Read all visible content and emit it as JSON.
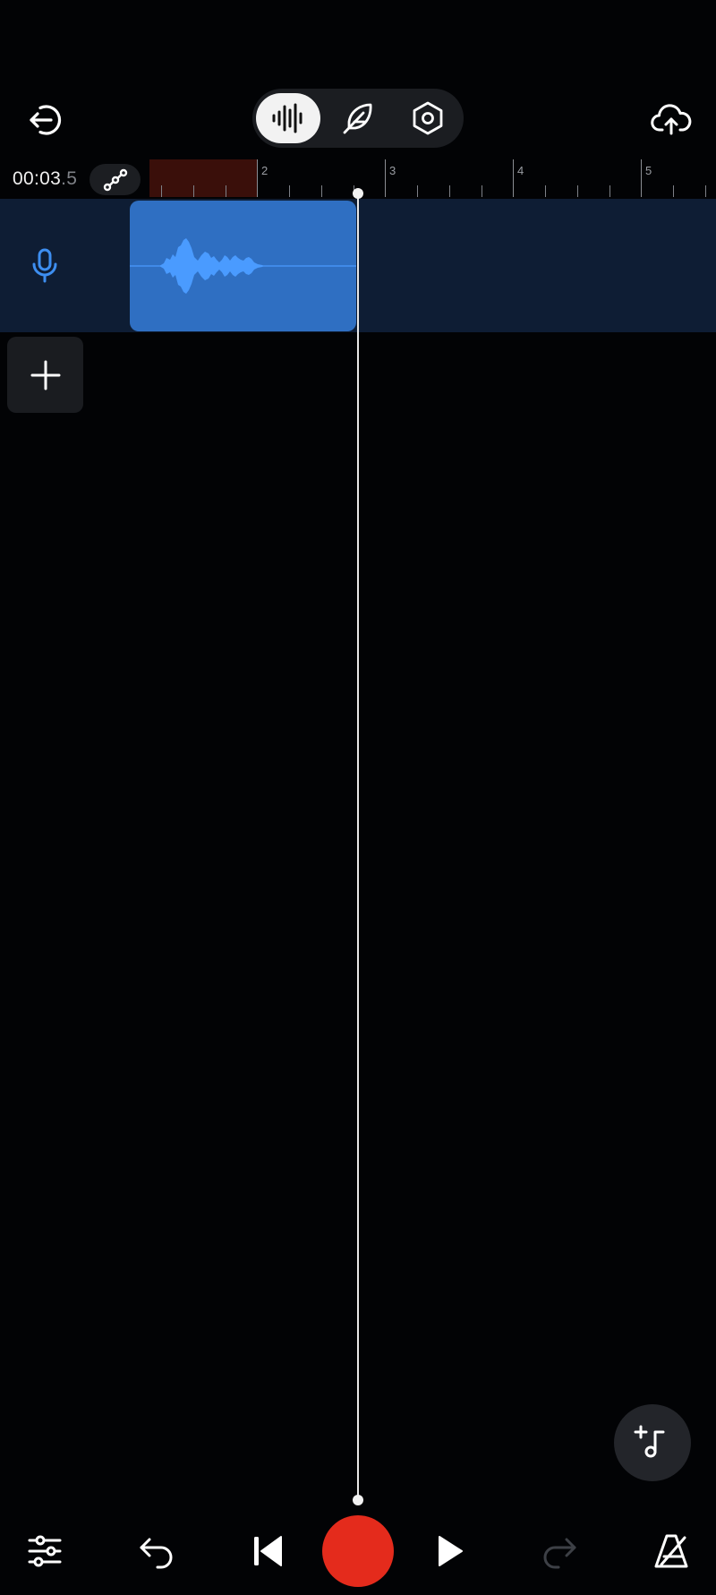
{
  "header": {
    "exit_icon": "exit-arrow-icon",
    "upload_icon": "cloud-upload-icon",
    "modes": [
      {
        "id": "waveform",
        "icon": "waveform-icon",
        "active": true
      },
      {
        "id": "feather",
        "icon": "feather-icon",
        "active": false
      },
      {
        "id": "settings",
        "icon": "hexagon-settings-icon",
        "active": false
      }
    ]
  },
  "transport_time": {
    "main": "00:03",
    "fraction": ".5"
  },
  "ruler": {
    "labels": [
      "2",
      "3",
      "4",
      "5"
    ]
  },
  "tracks": [
    {
      "type": "voice",
      "icon": "microphone-icon",
      "clip_color": "#2f6fc2"
    }
  ],
  "colors": {
    "background": "#020305",
    "track_lane": "#0e1d34",
    "clip": "#2f6fc2",
    "waveform": "#4a9bff",
    "loop_region": "#3a0f0a",
    "record": "#e42b1c"
  },
  "bottom_bar": {
    "icons": [
      "mixer-sliders-icon",
      "undo-icon",
      "skip-to-start-icon",
      "record-icon",
      "play-icon",
      "redo-icon",
      "metronome-icon"
    ],
    "redo_enabled": false
  }
}
